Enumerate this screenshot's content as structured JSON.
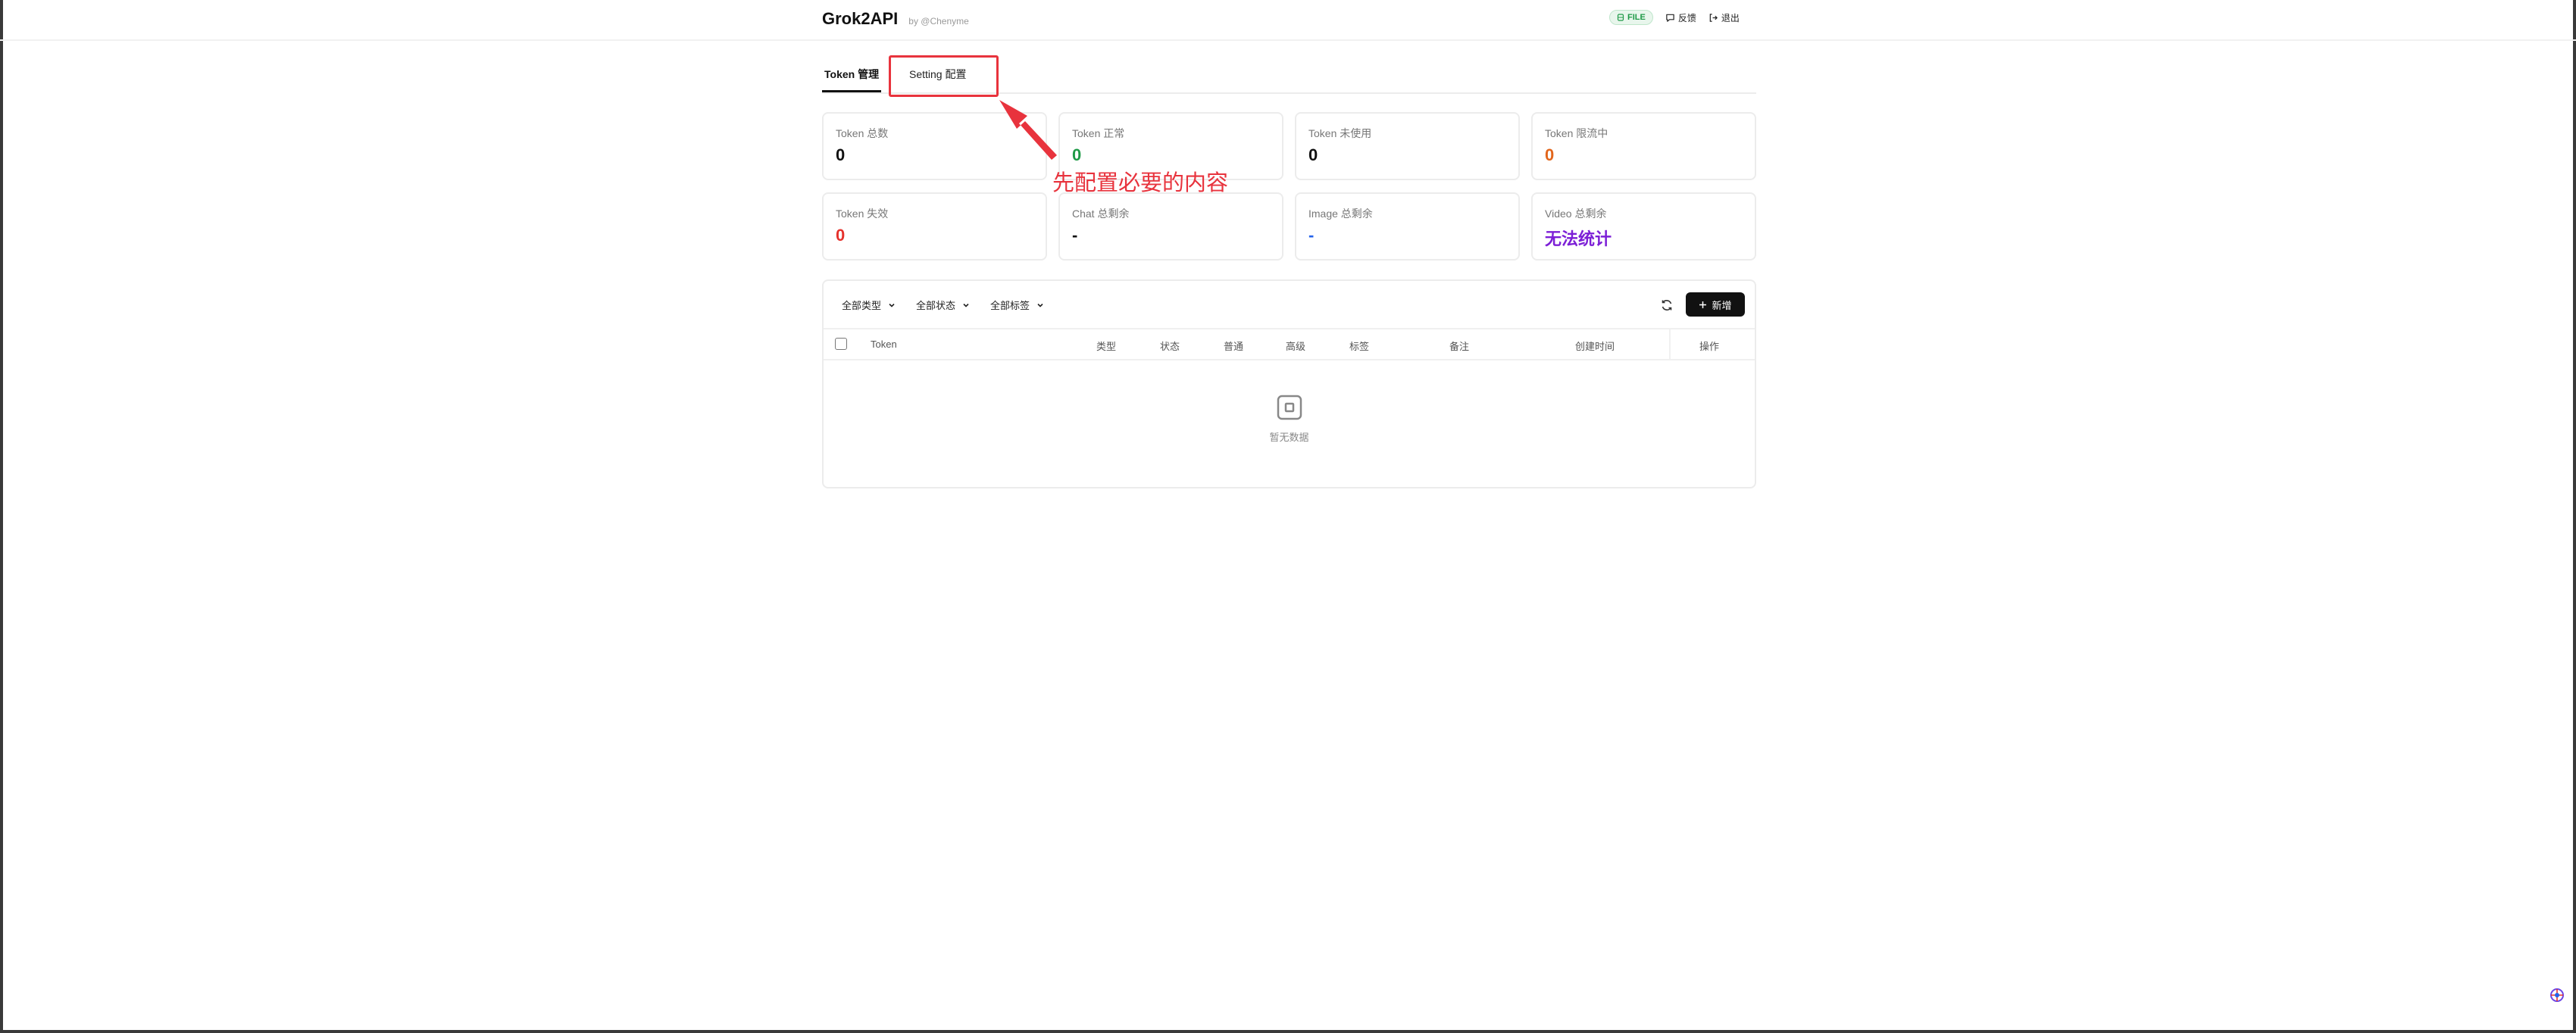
{
  "header": {
    "title": "Grok2API",
    "byline": "by @Chenyme",
    "storage_badge": "FILE",
    "feedback_label": "反馈",
    "logout_label": "退出"
  },
  "tabs": [
    {
      "label": "Token 管理",
      "active": true
    },
    {
      "label": "Setting 配置",
      "active": false
    }
  ],
  "stats": [
    {
      "label": "Token 总数",
      "value": "0",
      "color": "#111111"
    },
    {
      "label": "Token 正常",
      "value": "0",
      "color": "#1f9a47"
    },
    {
      "label": "Token 未使用",
      "value": "0",
      "color": "#111111"
    },
    {
      "label": "Token 限流中",
      "value": "0",
      "color": "#e2661c"
    },
    {
      "label": "Token 失效",
      "value": "0",
      "color": "#e5322d"
    },
    {
      "label": "Chat 总剩余",
      "value": "-",
      "color": "#111111"
    },
    {
      "label": "Image 总剩余",
      "value": "-",
      "color": "#2563eb"
    },
    {
      "label": "Video 总剩余",
      "value": "无法统计",
      "color": "#7c1fd6"
    }
  ],
  "annotation": {
    "text": "先配置必要的内容",
    "color": "#e8333d"
  },
  "toolbar": {
    "filter_type": "全部类型",
    "filter_status": "全部状态",
    "filter_tag": "全部标签",
    "add_label": "新增"
  },
  "table": {
    "columns": [
      "Token",
      "类型",
      "状态",
      "普通",
      "高级",
      "标签",
      "备注",
      "创建时间",
      "操作"
    ],
    "empty_text": "暂无数据"
  }
}
